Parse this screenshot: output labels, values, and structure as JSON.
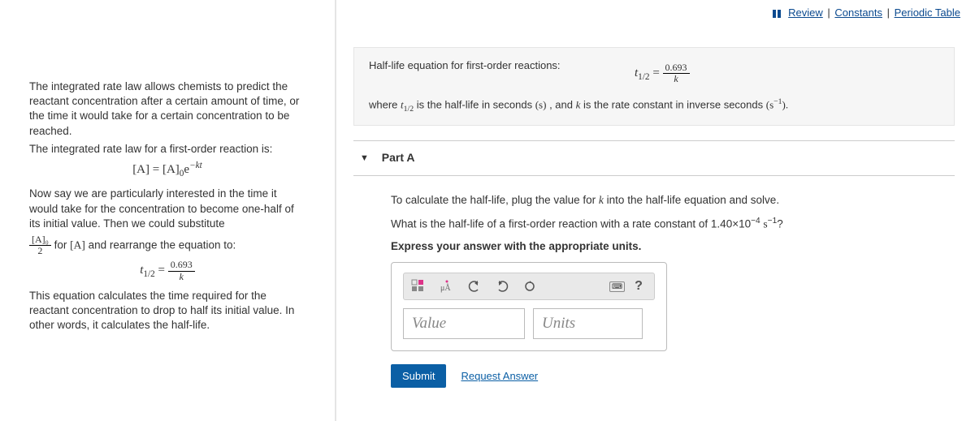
{
  "topbar": {
    "review": "Review",
    "constants": "Constants",
    "periodic": "Periodic Table"
  },
  "left": {
    "p1": "The integrated rate law allows chemists to predict the reactant concentration after a certain amount of time, or the time it would take for a certain concentration to be reached.",
    "p2": "The integrated rate law for a first-order reaction is:",
    "p3": "Now say we are particularly interested in the time it would take for the concentration to become one-half of its initial value. Then we could substitute",
    "p4_tail": " and rearrange the equation to:",
    "p4_mid": " for ",
    "p5": "This equation calculates the time required for the reactant concentration to drop to half its initial value. In other words, it calculates the half-life.",
    "frac_num": "[A]₀",
    "frac_den": "2",
    "A_sym": "[A]",
    "eq1_lhs": "[A] = [A]",
    "eq1_sub": "0",
    "eq1_e": "e",
    "eq1_exp": "−kt",
    "eq2_lhs": "t",
    "eq2_sub": "1/2",
    "eq2_eq": " = ",
    "eq2_num": "0.693",
    "eq2_den": "k"
  },
  "info": {
    "title": "Half-life equation for first-order reactions:",
    "where_a": "where ",
    "where_b": " is the half-life in seconds ",
    "where_c": ", and ",
    "where_d": " is the rate constant in inverse seconds ",
    "s_unit": "(s)",
    "k_sym": "k",
    "s_inv": "(s",
    "s_inv2": ").",
    "t_sym": "t",
    "t_sub": "1/2",
    "minus1": "−1"
  },
  "part": {
    "label": "Part A",
    "q1_a": "To calculate the half-life, plug the value for ",
    "q1_b": " into the half-life equation and solve.",
    "k_sym": "k",
    "q2_a": "What is the half-life of a first-order reaction with a rate constant of 1.40×10",
    "q2_exp": "−4",
    "q2_b": "  s",
    "q2_exp2": "−1",
    "q2_c": "?",
    "instr": "Express your answer with the appropriate units.",
    "value_ph": "Value",
    "units_ph": "Units",
    "submit": "Submit",
    "request": "Request Answer",
    "help_q": "?"
  }
}
